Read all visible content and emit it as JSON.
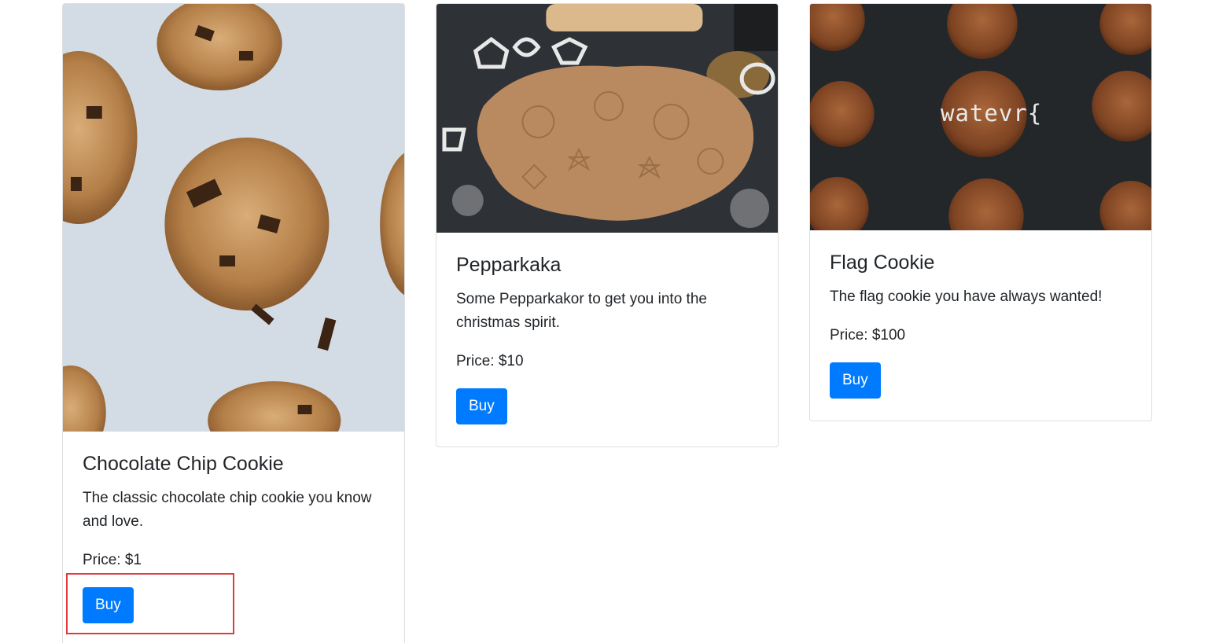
{
  "products": [
    {
      "image_alt": "chocolate chip cookies photo",
      "title": "Chocolate Chip Cookie",
      "description": "The classic chocolate chip cookie you know and love.",
      "price": "Price: $1",
      "button": "Buy"
    },
    {
      "image_alt": "pepparkakor dough with cookie cutters photo",
      "title": "Pepparkaka",
      "description": "Some Pepparkakor to get you into the christmas spirit.",
      "price": "Price: $10",
      "button": "Buy"
    },
    {
      "image_alt": "ginger cookies on dark background photo",
      "image_overlay_text": "watevr{",
      "title": "Flag Cookie",
      "description": "The flag cookie you have always wanted!",
      "price": "Price: $100",
      "button": "Buy"
    }
  ],
  "colors": {
    "primary": "#007bff",
    "highlight": "#e0393e",
    "card_border": "#dfdfdf"
  }
}
